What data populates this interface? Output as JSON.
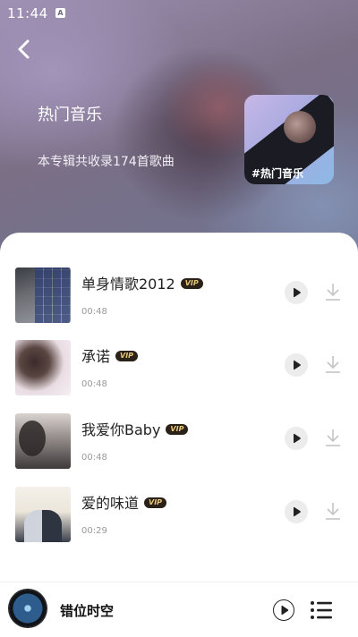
{
  "status_bar": {
    "time": "11:44",
    "notification_icon": "A"
  },
  "header": {
    "back_icon": "chevron-left-icon",
    "album_title": "热门音乐",
    "album_description": "本专辑共收录174首歌曲",
    "cover_label": "#热门音乐"
  },
  "songs": [
    {
      "title": "单身情歌2012",
      "vip": "VIP",
      "duration": "00:48"
    },
    {
      "title": "承诺",
      "vip": "VIP",
      "duration": "00:48"
    },
    {
      "title": "我爱你Baby",
      "vip": "VIP",
      "duration": "00:48"
    },
    {
      "title": "爱的味道",
      "vip": "VIP",
      "duration": "00:29"
    }
  ],
  "player": {
    "now_playing": "错位时空"
  },
  "colors": {
    "vip_badge_bg": "#2a2118",
    "vip_badge_text": "#e8c77a",
    "accent_dark": "#222222"
  }
}
